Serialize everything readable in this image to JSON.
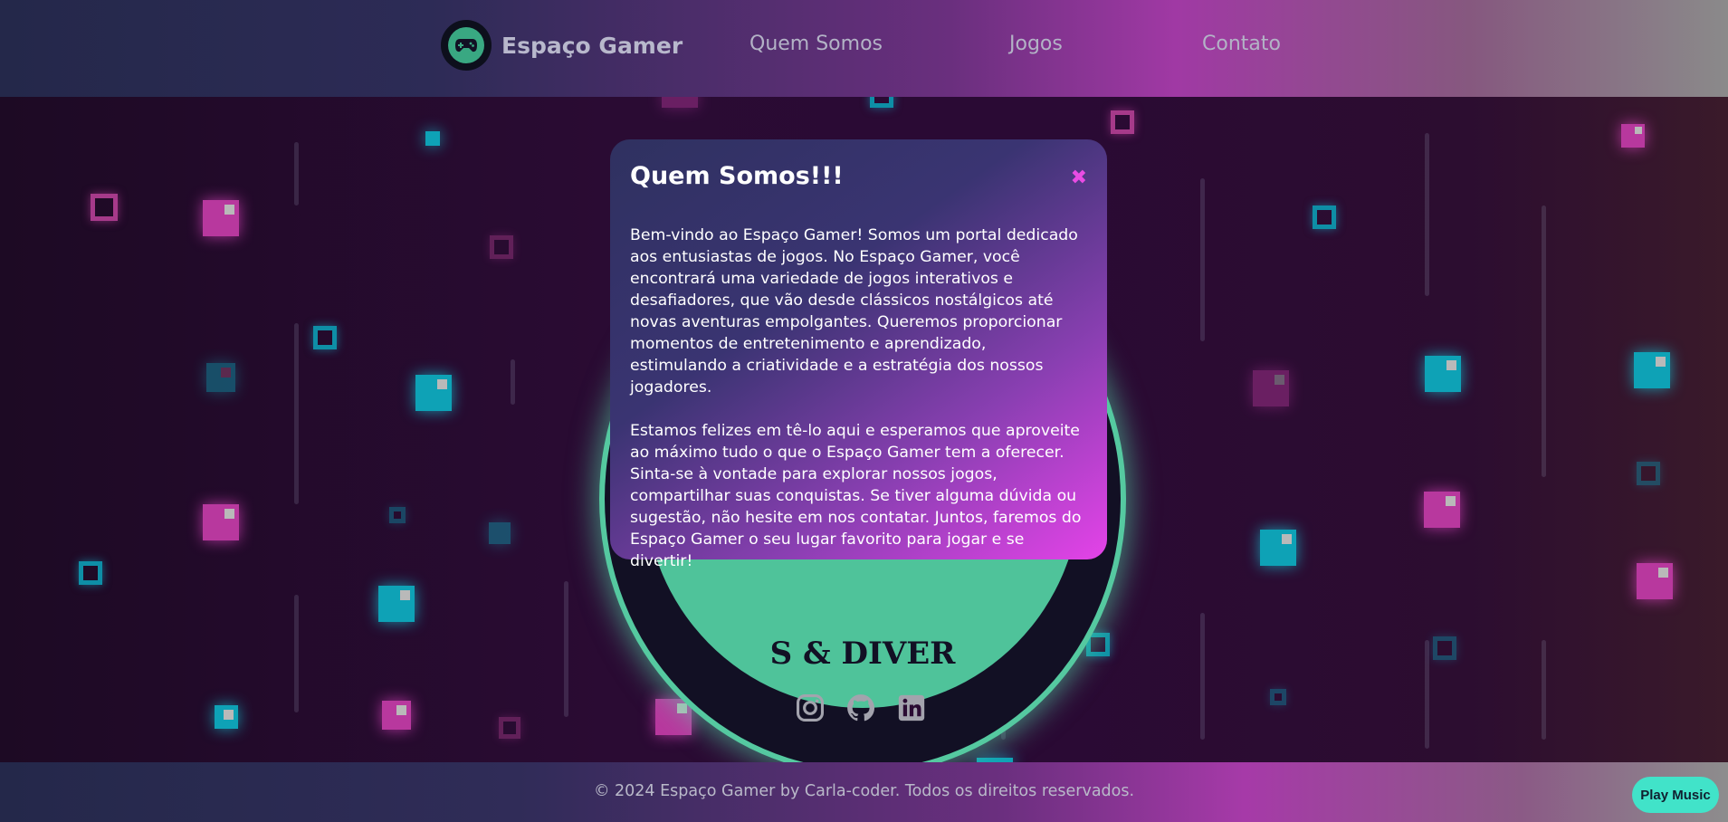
{
  "header": {
    "brand_name": "Espaço Gamer",
    "logo_icon": "gamepad-icon",
    "nav": [
      {
        "label": "Quem Somos"
      },
      {
        "label": "Jogos"
      },
      {
        "label": "Contato"
      }
    ]
  },
  "hero": {
    "circle_text": "S & DIVER"
  },
  "modal": {
    "title": "Quem Somos!!!",
    "close_icon": "close-icon",
    "paragraphs": [
      "Bem-vindo ao Espaço Gamer! Somos um portal dedicado aos entusiastas de jogos. No Espaço Gamer, você encontrará uma variedade de jogos interativos e desafiadores, que vão desde clássicos nostálgicos até novas aventuras empolgantes. Queremos proporcionar momentos de entretenimento e aprendizado, estimulando a criatividade e a estratégia dos nossos jogadores.",
      "Estamos felizes em tê-lo aqui e esperamos que aproveite ao máximo tudo o que o Espaço Gamer tem a oferecer. Sinta-se à vontade para explorar nossos jogos, compartilhar suas conquistas. Se tiver alguma dúvida ou sugestão, não hesite em nos contatar. Juntos, faremos do Espaço Gamer o seu lugar favorito para jogar e se divertir!"
    ]
  },
  "socials": [
    {
      "icon": "instagram-icon"
    },
    {
      "icon": "github-icon"
    },
    {
      "icon": "linkedin-icon"
    }
  ],
  "footer": {
    "text": "© 2024 Espaço Gamer by Carla-coder. Todos os direitos reservados."
  },
  "music_button": {
    "label": "Play Music"
  },
  "colors": {
    "accent_pink": "#e443e8",
    "accent_cyan": "#0ea2b6",
    "accent_green": "#4fc39a",
    "music_button": "#41e3c9"
  }
}
